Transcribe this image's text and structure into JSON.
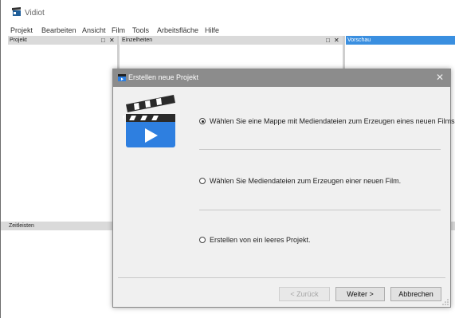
{
  "app": {
    "title": "Vidiot",
    "icon": "film-app-icon"
  },
  "menu": [
    "Projekt",
    "Bearbeiten",
    "Ansicht",
    "Film",
    "Tools",
    "Arbeitsfläche",
    "Hilfe"
  ],
  "panes": {
    "projekt": {
      "title": "Projekt"
    },
    "einzelheiten": {
      "title": "Einzelheiten"
    },
    "vorschau": {
      "title": "Vorschau"
    },
    "zeitleisten": {
      "title": "Zeitleisten"
    }
  },
  "pane_controls": {
    "maximize": "□",
    "close": "✕"
  },
  "dialog": {
    "title": "Erstellen neue Projekt",
    "close_glyph": "✕",
    "options": [
      {
        "label": "Wählen Sie eine Mappe mit Mediendateien zum Erzeugen eines neuen Films.",
        "checked": true
      },
      {
        "label": "Wählen Sie Mediendateien zum Erzeugen einer neuen Film.",
        "checked": false
      },
      {
        "label": "Erstellen von ein leeres Projekt.",
        "checked": false
      }
    ],
    "buttons": {
      "back": "< Zurück",
      "next": "Weiter >",
      "cancel": "Abbrechen"
    }
  },
  "colors": {
    "active_header": "#3a8fe0",
    "dialog_title": "#8c8c8c",
    "clapper_blue": "#2e7fe0"
  }
}
